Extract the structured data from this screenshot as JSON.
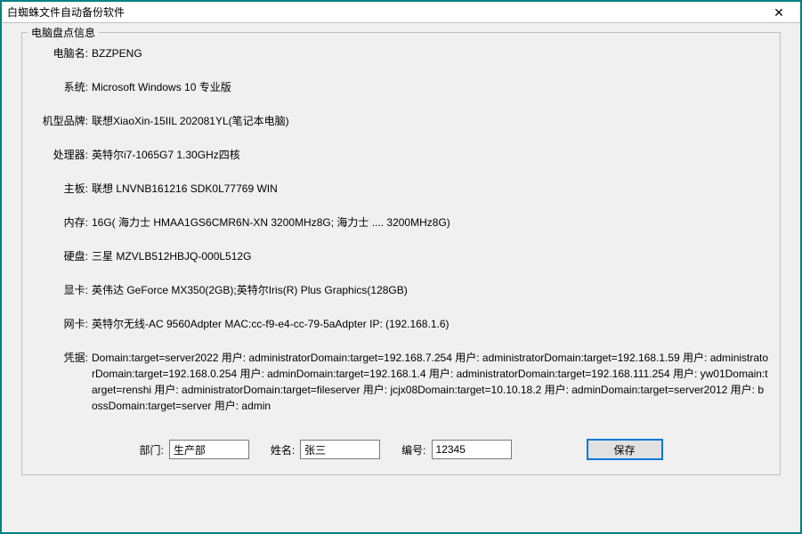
{
  "window": {
    "title": "白蜘蛛文件自动备份软件",
    "close_glyph": "✕"
  },
  "panel": {
    "legend": "电脑盘点信息"
  },
  "info": {
    "computer_name": {
      "label": "电脑名:",
      "value": "BZZPENG"
    },
    "system": {
      "label": "系统:",
      "value": "Microsoft Windows 10 专业版"
    },
    "model": {
      "label": "机型品牌:",
      "value": "联想XiaoXin-15IIL 202081YL(笔记本电脑)"
    },
    "cpu": {
      "label": "处理器:",
      "value": "英特尔i7-1065G7 1.30GHz四核"
    },
    "mainboard": {
      "label": "主板:",
      "value": "联想 LNVNB161216 SDK0L77769 WIN"
    },
    "memory": {
      "label": "内存:",
      "value": "16G( 海力士 HMAA1GS6CMR6N-XN 3200MHz8G; 海力士 .... 3200MHz8G)"
    },
    "disk": {
      "label": "硬盘:",
      "value": "三星 MZVLB512HBJQ-000L512G"
    },
    "gpu": {
      "label": "显卡:",
      "value": "英伟达 GeForce MX350(2GB);英特尔Iris(R) Plus Graphics(128GB)"
    },
    "nic": {
      "label": "网卡:",
      "value": "英特尔无线-AC 9560Adpter MAC:cc-f9-e4-cc-79-5aAdpter IP: (192.168.1.6)"
    },
    "credentials": {
      "label": "凭据:",
      "value": "Domain:target=server2022 用户: administratorDomain:target=192.168.7.254 用户: administratorDomain:target=192.168.1.59 用户: administratorDomain:target=192.168.0.254 用户: adminDomain:target=192.168.1.4 用户: administratorDomain:target=192.168.111.254 用户: yw01Domain:target=renshi 用户: administratorDomain:target=fileserver 用户: jcjx08Domain:target=10.10.18.2 用户: adminDomain:target=server2012 用户: bossDomain:target=server 用户: admin"
    }
  },
  "form": {
    "department": {
      "label": "部门:",
      "value": "生产部"
    },
    "name": {
      "label": "姓名:",
      "value": "张三"
    },
    "number": {
      "label": "编号:",
      "value": "12345"
    },
    "save_label": "保存"
  }
}
